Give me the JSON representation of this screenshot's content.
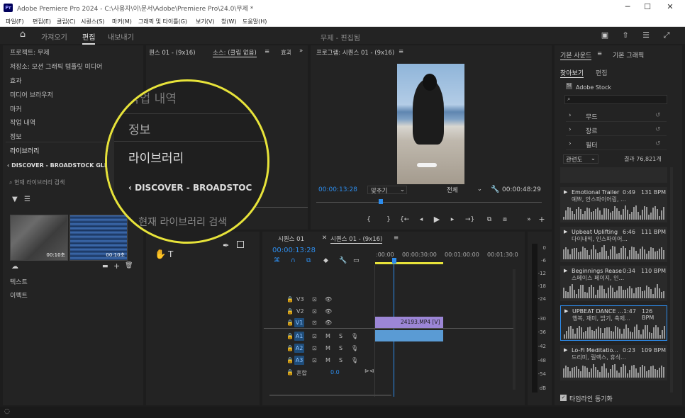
{
  "app": {
    "title": "Adobe Premiere Pro 2024 - C:\\사용자\\이\\문서\\Adobe\\Premiere Pro\\24.0\\무제 *",
    "logo": "Pr"
  },
  "menu": [
    "파일(F)",
    "편집(E)",
    "클립(C)",
    "시퀀스(S)",
    "마커(M)",
    "그래픽 및 타이틀(G)",
    "보기(V)",
    "창(W)",
    "도움말(H)"
  ],
  "workspace": {
    "tabs": [
      "가져오기",
      "편집",
      "내보내기"
    ],
    "active": "편집",
    "center_title": "무제 - 편집됨"
  },
  "left_panel": {
    "items": [
      "프로젝트: 무제",
      "저장소: 모션 그래픽 템플릿 미디어",
      "효과",
      "미디어 브라우저",
      "마커",
      "작업 내역",
      "정보",
      "라이브러리"
    ],
    "discover": "DISCOVER - BROADSTOCK GLITCHES",
    "search_placeholder": "현재 라이브러리 검색",
    "thumbs": [
      {
        "dur": "00:10초"
      },
      {
        "dur": "00:10초"
      }
    ],
    "bottom_items": [
      "텍스트",
      "이펙트"
    ]
  },
  "magnifier": {
    "items": [
      "작업 내역",
      "정보",
      "라이브러리"
    ],
    "discover": "DISCOVER - BROADSTOC",
    "search": "현재 라이브러리 검색"
  },
  "source_panel": {
    "tabs": [
      "퀀스 01 - (9x16)",
      "소스: (클립 없음)",
      "효과"
    ],
    "menu_icon": "≡"
  },
  "program_monitor": {
    "title": "프로그램: 시퀀스 01 - (9x16)",
    "timecode": "00:00:13:28",
    "fit": "맞추기",
    "quality": "전체",
    "duration": "00:48:29",
    "duration_full": "00:00:48:29"
  },
  "timeline": {
    "tabs": [
      "시퀀스 01",
      "시퀀스 01 - (9x16)"
    ],
    "timecode": "00:00:13:28",
    "ruler": [
      ":00:00",
      "00:00:30:00",
      "00:01:00:00",
      "00:01:30:0"
    ],
    "video_tracks": [
      "V3",
      "V2",
      "V1"
    ],
    "audio_tracks": [
      "A1",
      "A2",
      "A3"
    ],
    "mix_label": "혼합",
    "mix_value": "0.0",
    "clip_name": "24193.MP4 [V]",
    "vu_scale": [
      "0",
      "-6",
      "-12",
      "-18",
      "-24",
      "-30",
      "-36",
      "-42",
      "-48",
      "-54",
      "dB"
    ]
  },
  "essential_sound": {
    "tabs": [
      "기본 사운드",
      "기본 그래픽"
    ],
    "subtabs": [
      "찾아보기",
      "편집"
    ],
    "stock": "Adobe Stock",
    "filters": [
      "무드",
      "장르",
      "필터"
    ],
    "sort": "관련도",
    "results": "결과 76,821개",
    "sync_label": "타임라인 동기화",
    "cards": [
      {
        "title": "Emotional Trailer",
        "sub": "예쁘, 안스파이어링, ...",
        "dur": "0:49",
        "bpm": "131 BPM"
      },
      {
        "title": "Upbeat Uplifting",
        "sub": "다이내믹, 인스파이어...",
        "dur": "6:46",
        "bpm": "111 BPM"
      },
      {
        "title": "Beginnings Rease",
        "sub": "스페이스 페이지, 인...",
        "dur": "0:34",
        "bpm": "110 BPM"
      },
      {
        "title": "UPBEAT DANCE ...",
        "sub": "행복, 재미, 밝기, 축제...",
        "dur": "1:47",
        "bpm": "126 BPM"
      },
      {
        "title": "Lo-Fi Meditatio...",
        "sub": "드리미, 릴렉스, 휴식...",
        "dur": "0:23",
        "bpm": "109 BPM"
      }
    ]
  },
  "colors": {
    "accent": "#2d8ceb",
    "yellow": "#e7e33a",
    "clip": "#9c86d6",
    "audio_clip": "#5a9bd4"
  }
}
